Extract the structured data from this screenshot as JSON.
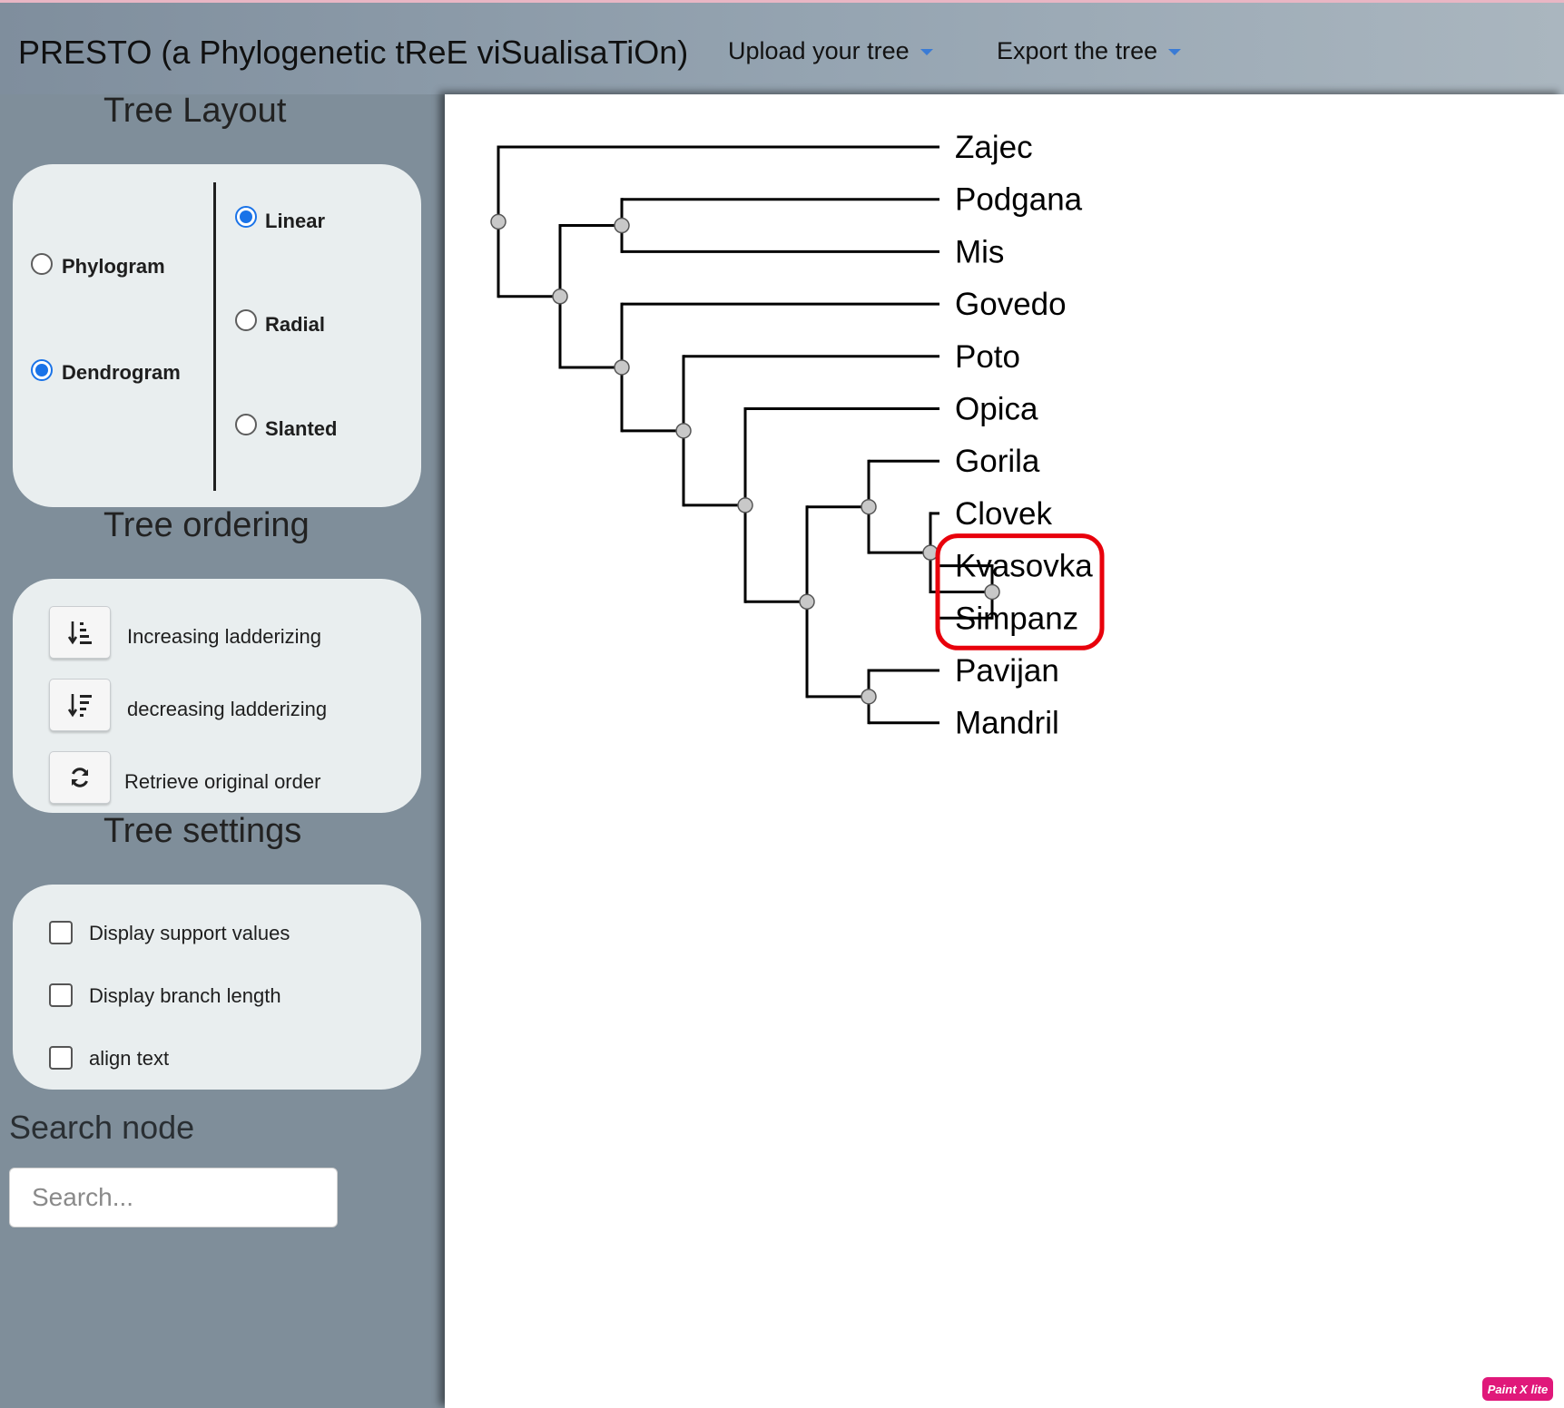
{
  "header": {
    "title": "PRESTO (a Phylogenetic tReE viSualisaTiOn)",
    "menus": [
      {
        "label": "Upload your tree"
      },
      {
        "label": "Export the tree"
      }
    ]
  },
  "sidebar": {
    "layout": {
      "title": "Tree Layout",
      "type_options": [
        {
          "label": "Phylogram",
          "checked": false
        },
        {
          "label": "Dendrogram",
          "checked": true
        }
      ],
      "shape_options": [
        {
          "label": "Linear",
          "checked": true
        },
        {
          "label": "Radial",
          "checked": false
        },
        {
          "label": "Slanted",
          "checked": false
        }
      ]
    },
    "ordering": {
      "title": "Tree ordering",
      "buttons": [
        {
          "label": "Increasing ladderizing",
          "icon": "sort-amount-down-icon"
        },
        {
          "label": "decreasing ladderizing",
          "icon": "sort-amount-up-icon"
        },
        {
          "label": "Retrieve original order",
          "icon": "refresh-icon"
        }
      ]
    },
    "settings": {
      "title": "Tree settings",
      "checkboxes": [
        {
          "label": "Display support values",
          "checked": false
        },
        {
          "label": "Display branch length",
          "checked": false
        },
        {
          "label": "align text",
          "checked": false
        }
      ]
    },
    "search": {
      "title": "Search node",
      "placeholder": "Search...",
      "value": ""
    }
  },
  "tree": {
    "leaves": [
      "Zajec",
      "Podgana",
      "Mis",
      "Govedo",
      "Poto",
      "Opica",
      "Gorila",
      "Clovek",
      "Kvasovka",
      "Simpanz",
      "Pavijan",
      "Mandril"
    ],
    "newick": "(Zajec,((Podgana,Mis),(Govedo,(Poto,(Opica,((Gorila,(Clovek,(Kvasovka,Simpanz))),(Pavijan,Mandril)))))));",
    "highlighted_leaves": [
      "Kvasovka",
      "Simpanz"
    ],
    "highlight_color": "#e8000b",
    "branch_color": "#000000",
    "node_color": "#c8c8c8"
  },
  "watermark": "Paint X lite"
}
